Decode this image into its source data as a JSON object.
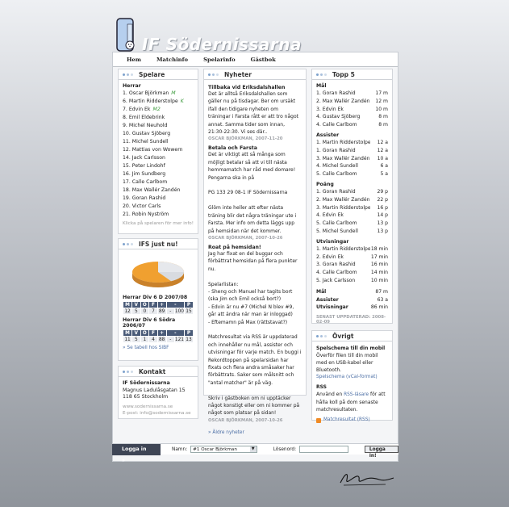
{
  "site": {
    "title": "IF Södernissarna"
  },
  "nav": [
    "Hem",
    "Matchinfo",
    "Spelarinfo",
    "Gästbok"
  ],
  "spelare": {
    "title": "Spelare",
    "group": "Herrar",
    "items": [
      {
        "text": "1. Oscar Björkman",
        "mark": "M"
      },
      {
        "text": "6. Martin Ridderstolpe",
        "mark": "K"
      },
      {
        "text": "7. Edvin Ek",
        "mark": "M2"
      },
      {
        "text": "8. Emil Eldebrink",
        "mark": ""
      },
      {
        "text": "9. Michel Neuhold",
        "mark": ""
      },
      {
        "text": "10. Gustav Sjöberg",
        "mark": ""
      },
      {
        "text": "11. Michel Sundell",
        "mark": ""
      },
      {
        "text": "12. Mattias von Wowern",
        "mark": ""
      },
      {
        "text": "14. Jack Carlsson",
        "mark": ""
      },
      {
        "text": "15. Peter Lindohf",
        "mark": ""
      },
      {
        "text": "16. Jim Sundberg",
        "mark": ""
      },
      {
        "text": "17. Calle Carlbom",
        "mark": ""
      },
      {
        "text": "18. Max Wallér Zandén",
        "mark": ""
      },
      {
        "text": "19. Goran Rashid",
        "mark": ""
      },
      {
        "text": "20. Victor Carls",
        "mark": ""
      },
      {
        "text": "21. Robin Nyström",
        "mark": ""
      }
    ],
    "footer": "Klicka på spelaren för mer info!"
  },
  "ifs": {
    "title": "IFS just nu!",
    "tables": [
      {
        "heading": "Herrar Div 6 D 2007/08",
        "head": [
          "M",
          "V",
          "O",
          "F",
          "+",
          "-",
          "P"
        ],
        "row": [
          "12",
          "5",
          "0",
          "7",
          "89",
          "-",
          "100",
          "15"
        ]
      },
      {
        "heading": "Herrar Div 6 Södra 2006/07",
        "head": [
          "M",
          "V",
          "O",
          "F",
          "+",
          "-",
          "P"
        ],
        "row": [
          "11",
          "5",
          "1",
          "4",
          "88",
          "-",
          "121",
          "13"
        ]
      }
    ],
    "link": "» Se tabell hos SIBF"
  },
  "kontakt": {
    "title": "Kontakt",
    "name": "IF Södernissarna",
    "address": "Magnus Ladulåsgatan 15",
    "city": "118 65 Stockholm",
    "web": "www.sodernissarna.se",
    "email": "E-post: info@sodernissarna.se"
  },
  "nyheter": {
    "title": "Nyheter",
    "items": [
      {
        "title": "Tillbaka vid Eriksdalshallen",
        "text": "Det är alltså Eriksdalshallen som gäller nu på tisdagar. Ber om ursäkt ifall den tidigare nyheten om träningar i Farsta rått er att tro något annat. Samma tider som innan, 21:30-22:30. Vi ses där..",
        "meta": "OSCAR BJÖRKMAN, 2007-11-20"
      },
      {
        "title": "Betala och Farsta",
        "text": "Det är viktigt att så många som möjligt betalar så att vi till nästa hemmamatch har råd med domare! Pengarna ska in på\n\nPG 133 29 08-1 IF Södernissarna\n\nGlöm inte heller att efter nästa träning blir det några träningar ute i Farsta. Mer info om detta läggs upp på hemsidan när det kommer.",
        "meta": "OSCAR BJÖRKMAN, 2007-10-26"
      },
      {
        "title": "Roat på hemsidan!",
        "text": "Jag har fixat en del buggar och förbättrat hemsidan på flera punkter nu.\n\nSpelarlistan:\n- Sheng och Manuel har tagits bort (ska Jim och Emil också bort?)\n- Edvin är nu #7 (Michel N blev #9, går att ändra när man är inloggad)\n- Eftemamn på Max (rättstavat?)\n\nMatchresultat via RSS är uppdaterad och innehåller nu mål, assister och utvisningar för varje match. En buggi i Rekordtoppen på spelarsidan har fixats och flera andra småsaker har förbättrats. Saker som målsnitt och \"antal matcher\" är på väg.\n\nSkriv i gästboken om ni upptäcker något konstigt eller om ni kommer på något som platsar på sidan!",
        "meta": "OSCAR BJÖRKMAN, 2007-10-26"
      }
    ],
    "older": "» Äldre nyheter"
  },
  "topp5": {
    "title": "Topp 5",
    "sections": [
      {
        "heading": "Mål",
        "rows": [
          [
            "1. Goran Rashid",
            "17 m"
          ],
          [
            "2. Max Wallér Zandén",
            "12 m"
          ],
          [
            "3. Edvin Ek",
            "10 m"
          ],
          [
            "4. Gustav Sjöberg",
            "8 m"
          ],
          [
            "4. Calle Carlbom",
            "8 m"
          ]
        ]
      },
      {
        "heading": "Assister",
        "rows": [
          [
            "1. Martin Ridderstolpe",
            "12 a"
          ],
          [
            "1. Goran Rashid",
            "12 a"
          ],
          [
            "3. Max Wallér Zandén",
            "10 a"
          ],
          [
            "4. Michel Sundell",
            "6 a"
          ],
          [
            "5. Calle Carlbom",
            "5 a"
          ]
        ]
      },
      {
        "heading": "Poäng",
        "rows": [
          [
            "1. Goran Rashid",
            "29 p"
          ],
          [
            "2. Max Wallér Zandén",
            "22 p"
          ],
          [
            "3. Martin Ridderstolpe",
            "16 p"
          ],
          [
            "4. Edvin Ek",
            "14 p"
          ],
          [
            "5. Calle Carlbom",
            "13 p"
          ],
          [
            "5. Michel Sundell",
            "13 p"
          ]
        ]
      },
      {
        "heading": "Utvisningar",
        "rows": [
          [
            "1. Martin Ridderstolpe",
            "18 min"
          ],
          [
            "2. Edvin Ek",
            "17 min"
          ],
          [
            "3. Goran Rashid",
            "16 min"
          ],
          [
            "4. Calle Carlbom",
            "14 min"
          ],
          [
            "5. Jack Carlsson",
            "10 min"
          ]
        ]
      }
    ],
    "totals": [
      [
        "Mål",
        "87 m"
      ],
      [
        "Assister",
        "63 a"
      ],
      [
        "Utvisningar",
        "86 min"
      ]
    ],
    "updated": "SENAST UPPDATERAD: 2008-02-09"
  },
  "ovrigt": {
    "title": "Övrigt",
    "s1_title": "Spelschema till din mobil",
    "s1_text": "Överför filen till din mobil med en USB-kabel eller Bluetooth.",
    "s1_link": "Spelschema (vCal-format)",
    "s2_title": "RSS",
    "s2_pre": "Använd en ",
    "s2_link": "RSS-läsare",
    "s2_post": " för att hålla koll på dom senaste matchresultaten.",
    "rss_link": "Matchresultat (RSS)"
  },
  "login": {
    "tab": "Logga in »",
    "name_label": "Namn:",
    "name_value": "#1 Oscar Björkman",
    "pw_label": "Lösenord:",
    "button": "Logga in!"
  },
  "colors": {
    "accent": "#4a5b78",
    "link": "#4c6fa5",
    "marker_green": "#3d9a3d",
    "pie_orange": "#f0a030"
  }
}
